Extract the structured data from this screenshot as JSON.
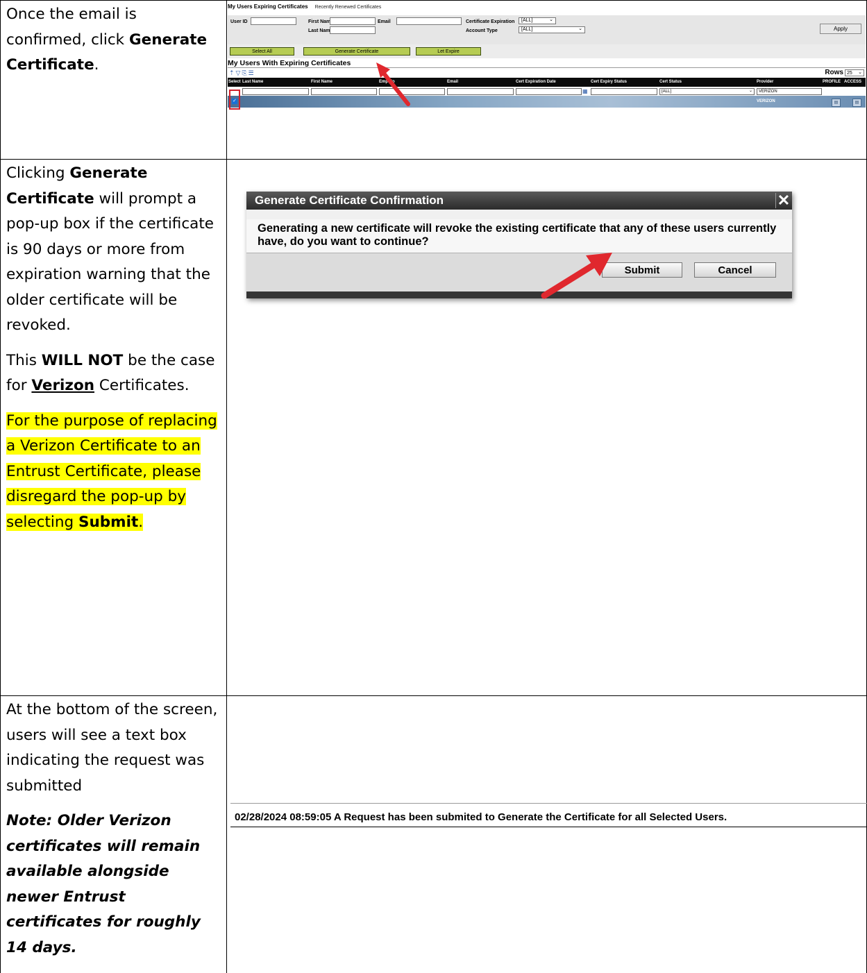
{
  "rows": [
    {
      "instructions": {
        "p1_before": "Once the email is confirmed, click",
        "p1_bold": "Generate Certificate",
        "p1_after": "."
      },
      "screenshot": {
        "tabs": [
          "My Users Expiring Certificates",
          "Recently Renewed Certificates"
        ],
        "filters": {
          "user_id_label": "User ID",
          "first_name_label": "First Name",
          "last_name_label": "Last Name",
          "email_label": "Email",
          "cert_expiration_label": "Certificate Expiration",
          "cert_expiration_value": "[ALL]",
          "account_type_label": "Account Type",
          "account_type_value": "[ALL]",
          "apply_label": "Apply"
        },
        "actions": [
          "Select All",
          "Generate Certificate",
          "Let Expire"
        ],
        "grid_title": "My Users With Expiring Certificates",
        "rows_label": "Rows",
        "rows_value": "25",
        "columns": [
          "Select",
          "Last Name",
          "First Name",
          "Emp No",
          "Email",
          "Cert Expiration Date",
          "Cert Expiry Status",
          "Cert Status",
          "Provider",
          "PROFILE",
          "ACCESS"
        ],
        "cert_status_filter": "[ALL]",
        "provider_filter": "VERIZON",
        "row_provider": "VERIZON"
      }
    },
    {
      "instructions": {
        "p1_t1": "Clicking",
        "p1_b1": "Generate Certificate",
        "p1_t2": "will prompt a pop-up box if the certificate is 90 days or more from expiration warning that the older certificate will be revoked.",
        "p2_t1": "This",
        "p2_b1": "WILL NOT",
        "p2_t2": "be the case for",
        "p2_bu": "Verizon",
        "p2_t3": "Certificates.",
        "p3_t1": "For the purpose of replacing a Verizon Certificate to an Entrust Certificate, please disregard the pop-up by selecting",
        "p3_b1": "Submit",
        "p3_t2": "."
      },
      "dialog": {
        "title": "Generate Certificate Confirmation",
        "close_glyph": "✕",
        "message": "Generating a new certificate will revoke the existing certificate that any of these users currently have, do you want to continue?",
        "submit_label": "Submit",
        "cancel_label": "Cancel"
      }
    },
    {
      "instructions": {
        "p1": "At the bottom of the screen, users will see a text box indicating the request was submitted",
        "p2": "Note: Older Verizon certificates will remain available alongside newer Entrust certificates for roughly 14 days."
      },
      "notice": "02/28/2024 08:59:05 A Request has been submited to Generate the Certificate for all Selected Users."
    }
  ],
  "colors": {
    "highlight": "#ffff00",
    "action_button": "#b6cc53",
    "callout_outline": "#d21f2b",
    "arrow": "#e0282e"
  }
}
